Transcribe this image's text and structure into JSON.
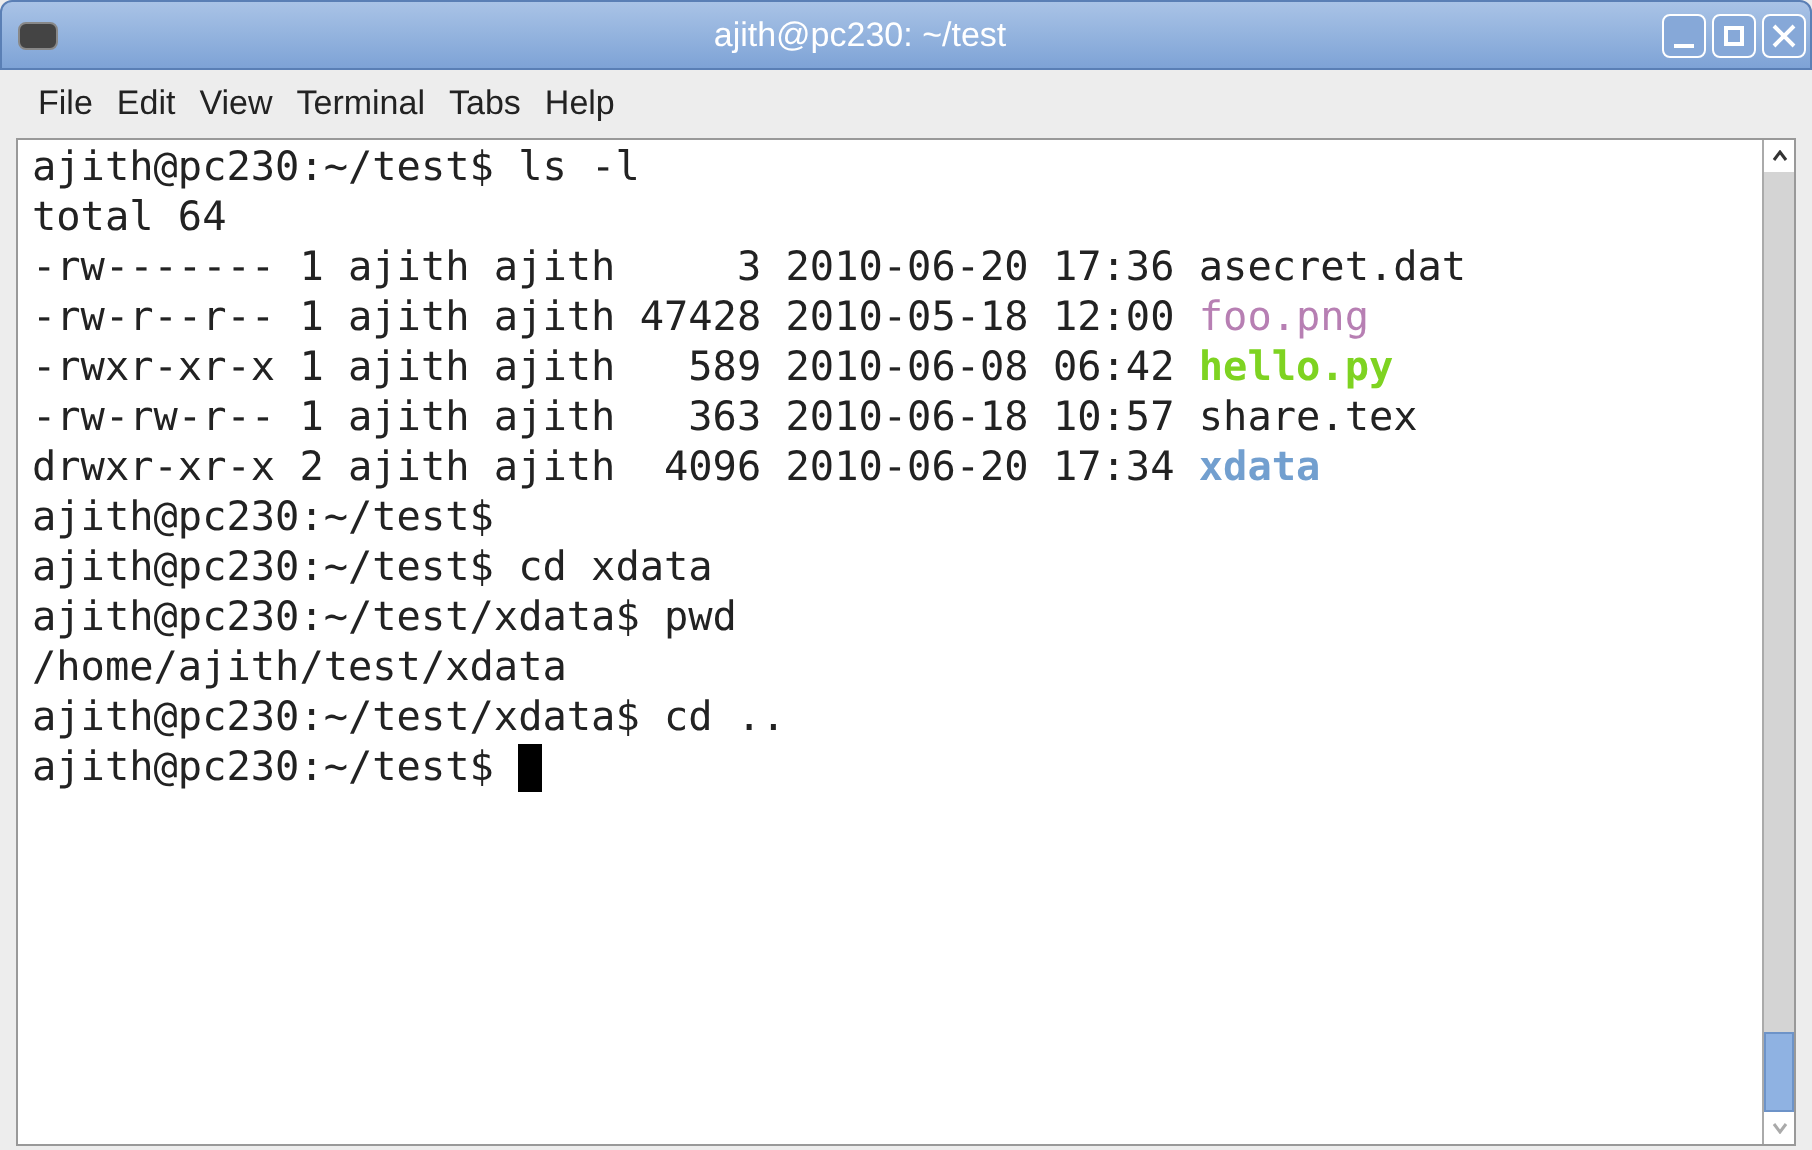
{
  "window": {
    "title": "ajith@pc230: ~/test"
  },
  "menu": [
    {
      "label": "File"
    },
    {
      "label": "Edit"
    },
    {
      "label": "View"
    },
    {
      "label": "Terminal"
    },
    {
      "label": "Tabs"
    },
    {
      "label": "Help"
    }
  ],
  "terminal": {
    "lines": [
      {
        "text": "ajith@pc230:~/test$ ls -l"
      },
      {
        "text": "total 64"
      },
      {
        "text": "-rw------- 1 ajith ajith     3 2010-06-20 17:36 ",
        "file": "asecret.dat"
      },
      {
        "text": "-rw-r--r-- 1 ajith ajith 47428 2010-05-18 12:00 ",
        "file": "foo.png",
        "color": "#b77fb3"
      },
      {
        "text": "-rwxr-xr-x 1 ajith ajith   589 2010-06-08 06:42 ",
        "file": "hello.py",
        "color": "#7ed321",
        "bold": true
      },
      {
        "text": "-rw-rw-r-- 1 ajith ajith   363 2010-06-18 10:57 ",
        "file": "share.tex"
      },
      {
        "text": "drwxr-xr-x 2 ajith ajith  4096 2010-06-20 17:34 ",
        "file": "xdata",
        "color": "#729fcf",
        "bold": true
      },
      {
        "text": "ajith@pc230:~/test$"
      },
      {
        "text": "ajith@pc230:~/test$ cd xdata"
      },
      {
        "text": "ajith@pc230:~/test/xdata$ pwd"
      },
      {
        "text": "/home/ajith/test/xdata"
      },
      {
        "text": "ajith@pc230:~/test/xdata$ cd .."
      },
      {
        "text": "ajith@pc230:~/test$ ",
        "cursor": true
      }
    ]
  }
}
